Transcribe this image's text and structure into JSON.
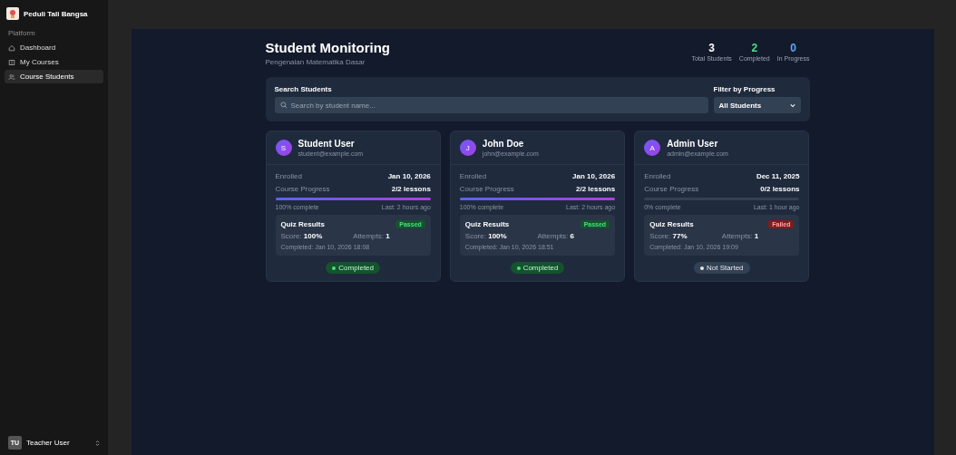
{
  "sidebar": {
    "brand": "Peduli Tali Bangsa",
    "section": "Platform",
    "items": [
      {
        "label": "Dashboard",
        "selected": false
      },
      {
        "label": "My Courses",
        "selected": false
      },
      {
        "label": "Course Students",
        "selected": true
      }
    ],
    "user": {
      "initials": "TU",
      "name": "Teacher User"
    }
  },
  "header": {
    "title": "Student Monitoring",
    "subtitle": "Pengenalan Matematika Dasar",
    "stats": [
      {
        "value": "3",
        "label": "Total Students",
        "color": "#ffffff"
      },
      {
        "value": "2",
        "label": "Completed",
        "color": "#4ade80"
      },
      {
        "value": "0",
        "label": "In Progress",
        "color": "#60a5fa"
      }
    ]
  },
  "filters": {
    "search_label": "Search Students",
    "search_placeholder": "Search by student name...",
    "filter_label": "Filter by Progress",
    "filter_value": "All Students"
  },
  "students": [
    {
      "initial": "S",
      "name": "Student User",
      "email": "student@example.com",
      "enrolled_label": "Enrolled",
      "enrolled": "Jan 10, 2026",
      "progress_label": "Course Progress",
      "lessons": "2/2 lessons",
      "level": 1,
      "percent": "100% complete",
      "last": "Last: 2 hours ago",
      "quiz_title": "Quiz Results",
      "quiz_status": {
        "kind": "passed",
        "label": "Passed"
      },
      "score_label": "Score:",
      "score": "100%",
      "attempts_label": "Attempts:",
      "attempts": "1",
      "completed_at": "Completed: Jan 10, 2026 18:08",
      "status": {
        "kind": "completed",
        "label": "Completed"
      }
    },
    {
      "initial": "J",
      "name": "John Doe",
      "email": "john@example.com",
      "enrolled_label": "Enrolled",
      "enrolled": "Jan 10, 2026",
      "progress_label": "Course Progress",
      "lessons": "2/2 lessons",
      "level": 1,
      "percent": "100% complete",
      "last": "Last: 2 hours ago",
      "quiz_title": "Quiz Results",
      "quiz_status": {
        "kind": "passed",
        "label": "Passed"
      },
      "score_label": "Score:",
      "score": "100%",
      "attempts_label": "Attempts:",
      "attempts": "6",
      "completed_at": "Completed: Jan 10, 2026 18:51",
      "status": {
        "kind": "completed",
        "label": "Completed"
      }
    },
    {
      "initial": "A",
      "name": "Admin User",
      "email": "admin@example.com",
      "enrolled_label": "Enrolled",
      "enrolled": "Dec 11, 2025",
      "progress_label": "Course Progress",
      "lessons": "0/2 lessons",
      "level": 0,
      "percent": "0% complete",
      "last": "Last: 1 hour ago",
      "quiz_title": "Quiz Results",
      "quiz_status": {
        "kind": "failed",
        "label": "Failed"
      },
      "score_label": "Score:",
      "score": "77%",
      "attempts_label": "Attempts:",
      "attempts": "1",
      "completed_at": "Completed: Jan 10, 2026 19:09",
      "status": {
        "kind": "not_started",
        "label": "Not Started"
      }
    }
  ]
}
